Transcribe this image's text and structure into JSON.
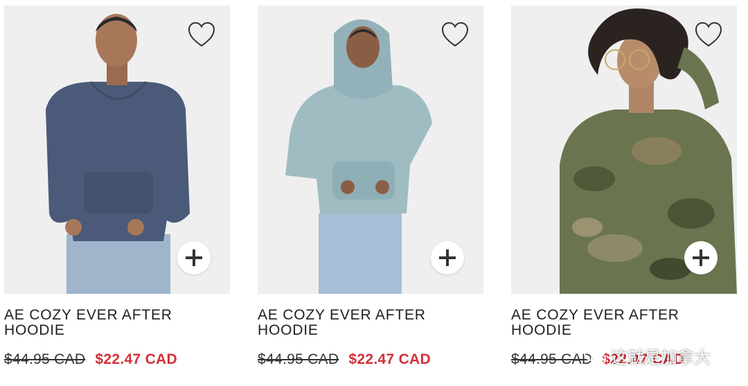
{
  "products": [
    {
      "name": "AE COZY EVER AFTER HOODIE",
      "original_price": "$44.95 CAD",
      "sale_price": "$22.47 CAD",
      "color": "#4a5a78",
      "photo": "navy-velour-hoodie-photo"
    },
    {
      "name": "AE COZY EVER AFTER HOODIE",
      "original_price": "$44.95 CAD",
      "sale_price": "$22.47 CAD",
      "color": "#9fbcc3",
      "photo": "light-blue-velour-hoodie-photo"
    },
    {
      "name": "AE COZY EVER AFTER HOODIE",
      "original_price": "$44.95 CAD",
      "sale_price": "$22.47 CAD",
      "color": "#5d6a44",
      "photo": "camo-velour-hoodie-photo"
    }
  ],
  "icons": {
    "favorite": "heart-outline-icon",
    "quick_add": "plus-icon"
  },
  "watermark": {
    "text": "这就是加拿大",
    "icon": "wechat-icon"
  },
  "colors": {
    "sale_price": "#d0313b",
    "text": "#1f1f1f",
    "photo_background": "#efefef"
  }
}
